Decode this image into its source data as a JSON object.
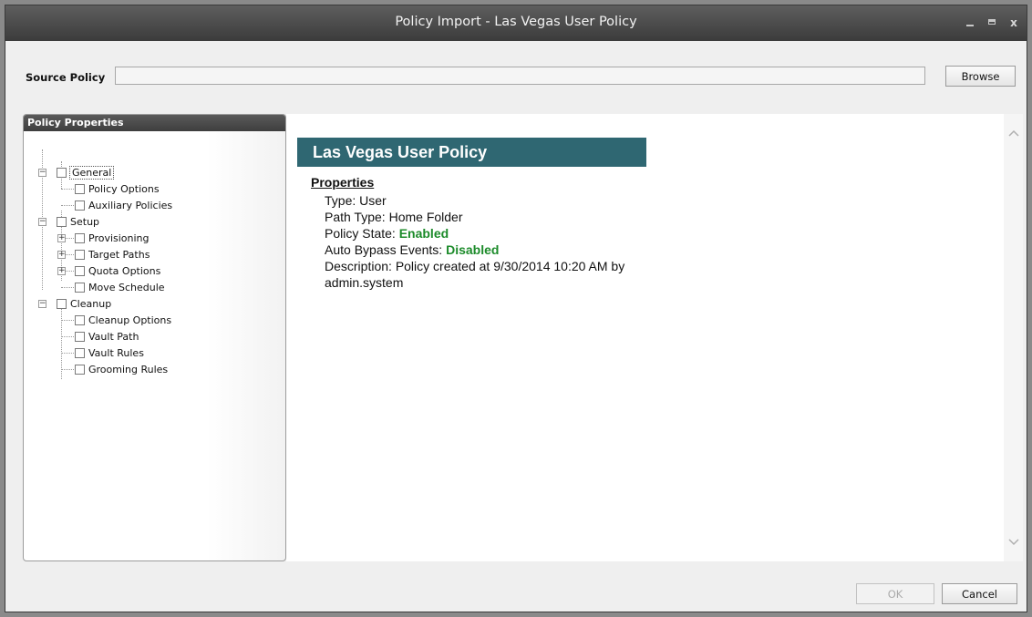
{
  "window": {
    "title": "Policy Import - Las Vegas User Policy",
    "controls": {
      "minimize": "_",
      "maximize": "□",
      "close": "x"
    }
  },
  "source_policy": {
    "label": "Source Policy",
    "value": "",
    "browse_label": "Browse"
  },
  "left_panel": {
    "header": "Policy Properties",
    "tree": {
      "general": "General",
      "policy_options": "Policy Options",
      "auxiliary_policies": "Auxiliary Policies",
      "setup": "Setup",
      "provisioning": "Provisioning",
      "target_paths": "Target Paths",
      "quota_options": "Quota Options",
      "move_schedule": "Move Schedule",
      "cleanup": "Cleanup",
      "cleanup_options": "Cleanup Options",
      "vault_path": "Vault Path",
      "vault_rules": "Vault Rules",
      "grooming_rules": "Grooming Rules"
    }
  },
  "details": {
    "policy_name": "Las Vegas User Policy",
    "properties_heading": "Properties",
    "type_label": "Type: ",
    "type_value": "User",
    "path_type_label": "Path Type: ",
    "path_type_value": "Home Folder",
    "policy_state_label": "Policy State: ",
    "policy_state_value": "Enabled",
    "auto_bypass_label": "Auto Bypass Events: ",
    "auto_bypass_value": "Disabled",
    "description_label": "Description: ",
    "description_value": "Policy created at 9/30/2014 10:20 AM by admin.system",
    "status_color": "#1c8b2a",
    "banner_color": "#2f6772"
  },
  "footer": {
    "ok_label": "OK",
    "cancel_label": "Cancel"
  }
}
